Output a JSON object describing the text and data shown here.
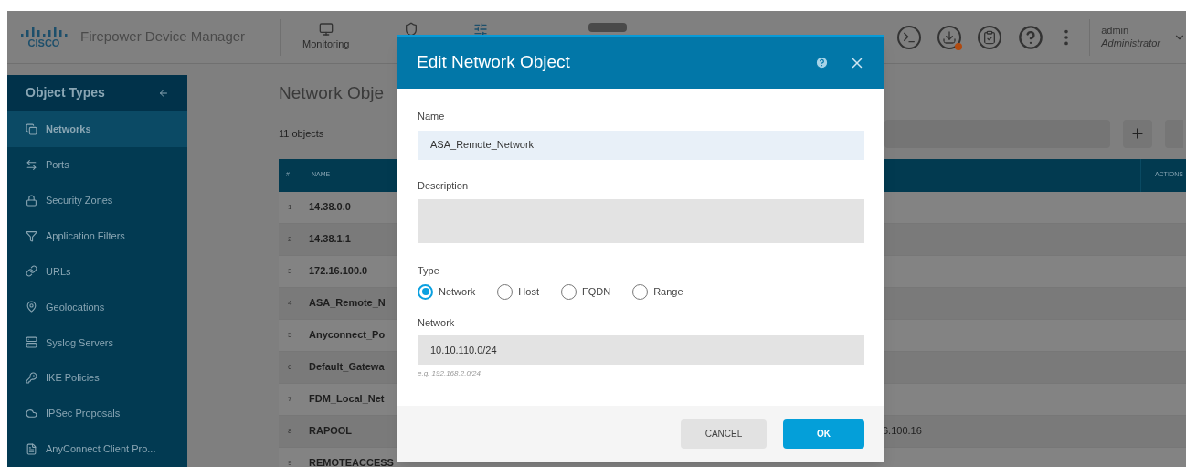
{
  "header": {
    "logo": "CISCO",
    "brand": "Firepower Device Manager",
    "nav": [
      {
        "label": "Monitoring"
      }
    ],
    "user": {
      "name": "admin",
      "role": "Administrator"
    }
  },
  "sidebar": {
    "title": "Object Types",
    "items": [
      {
        "label": "Networks",
        "selected": true
      },
      {
        "label": "Ports",
        "selected": false
      },
      {
        "label": "Security Zones",
        "selected": false
      },
      {
        "label": "Application Filters",
        "selected": false
      },
      {
        "label": "URLs",
        "selected": false
      },
      {
        "label": "Geolocations",
        "selected": false
      },
      {
        "label": "Syslog Servers",
        "selected": false
      },
      {
        "label": "IKE Policies",
        "selected": false
      },
      {
        "label": "IPSec Proposals",
        "selected": false
      },
      {
        "label": "AnyConnect Client Pro...",
        "selected": false
      }
    ]
  },
  "main": {
    "title": "Network Obje",
    "count": "11 objects",
    "table": {
      "columns": [
        "#",
        "NAME",
        "ACTIONS"
      ],
      "rows": [
        {
          "num": "1",
          "name": "14.38.0.0"
        },
        {
          "num": "2",
          "name": "14.38.1.1"
        },
        {
          "num": "3",
          "name": "172.16.100.0"
        },
        {
          "num": "4",
          "name": "ASA_Remote_N"
        },
        {
          "num": "5",
          "name": "Anyconnect_Po"
        },
        {
          "num": "6",
          "name": "Default_Gatewa"
        },
        {
          "num": "7",
          "name": "FDM_Local_Net"
        },
        {
          "num": "8",
          "name": "RAPOOL",
          "value": "6.100.16"
        },
        {
          "num": "9",
          "name": "REMOTEACCESS"
        }
      ]
    }
  },
  "modal": {
    "title": "Edit Network Object",
    "name": {
      "label": "Name",
      "value": "ASA_Remote_Network"
    },
    "description": {
      "label": "Description"
    },
    "type": {
      "label": "Type",
      "options": [
        {
          "label": "Network",
          "selected": true
        },
        {
          "label": "Host",
          "selected": false
        },
        {
          "label": "FQDN",
          "selected": false
        },
        {
          "label": "Range",
          "selected": false
        }
      ]
    },
    "network": {
      "label": "Network",
      "value": "10.10.110.0/24",
      "hint": "e.g. 192.168.2.0/24"
    },
    "buttons": [
      "CANCEL",
      "OK"
    ]
  }
}
